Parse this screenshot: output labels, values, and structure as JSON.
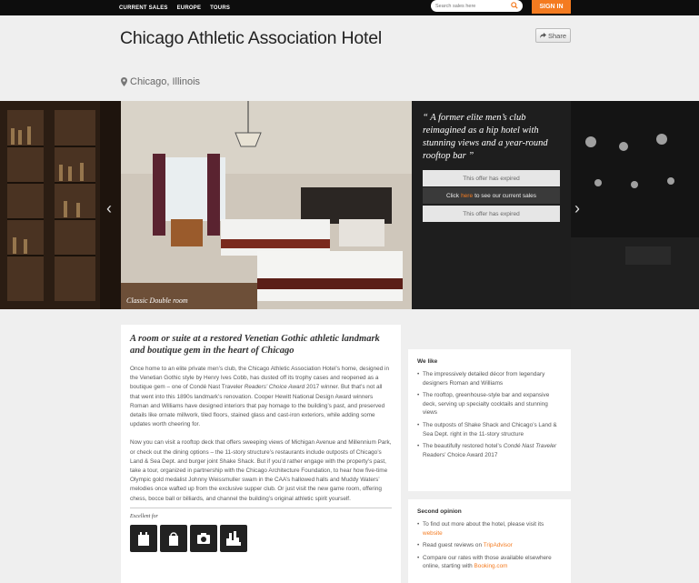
{
  "topnav": {
    "items": [
      "CURRENT SALES",
      "EUROPE",
      "TOURS"
    ],
    "search_placeholder": "Search sales here",
    "signin_label": "SIGN IN"
  },
  "header": {
    "title": "Chicago Athletic Association Hotel",
    "location": "Chicago, Illinois",
    "share_label": "Share"
  },
  "gallery": {
    "caption": "Classic Double room",
    "quote": "“ A former elite men’s club reimagined as a hip hotel with stunning views and a year-round rooftop bar ”",
    "offer_expired": "This offer has expired",
    "click_prefix": "Click",
    "click_link": "here",
    "click_suffix": "to see our current sales"
  },
  "article": {
    "headline": "A room or suite at a restored Venetian Gothic athletic landmark and boutique gem in the heart of Chicago",
    "p1_a": "Once home to an elite private men’s club, the Chicago Athletic Association Hotel’s home, designed in the Venetian Gothic style by Henry Ives Cobb, has dusted off its trophy cases and reopened as a boutique gem – one of Condé Nast Traveler ",
    "p1_em": "Readers’ Choice Award",
    "p1_b": " 2017 winner. But that’s not all that went into this 1890s landmark’s renovation. Cooper Hewitt National Design Award winners Roman and Williams have designed interiors that pay homage to the building’s past, and preserved details like ornate millwork, tiled floors, stained glass and cast-iron exteriors, while adding some updates worth cheering for.",
    "p2": "Now you can visit a rooftop deck that offers sweeping views of Michigan Avenue and Millennium Park, or check out the dining options – the 11-story structure’s restaurants include outposts of Chicago’s Land & Sea Dept. and burger joint Shake Shack. But if you’d rather engage with the property’s past, take a tour, organized in partnership with the Chicago Architecture Foundation, to hear how five-time Olympic gold medalist Johnny Weissmuller swam in the CAA’s hallowed halls and Muddy Waters’ melodies once wafted up from the exclusive supper club. Or just visit the new game room, offering chess, bocce ball or billiards, and channel the building’s original athletic spirit yourself.",
    "excellent_for": "Excellent for"
  },
  "we_like": {
    "title": "We like",
    "items": [
      "The impressively detailed décor from legendary designers Roman and Williams",
      "The rooftop, greenhouse-style bar and expansive deck, serving up specialty cocktails and stunning views",
      "The outposts of Shake Shack and Chicago’s Land & Sea Dept. right in the 11-story structure"
    ],
    "item4_a": "The beautifully restored hotel’s ",
    "item4_em": "Condé Nast Traveler",
    "item4_b": " Readers’ Choice Award 2017"
  },
  "second_opinion": {
    "title": "Second opinion",
    "item1": "To find out more about the hotel, please visit its",
    "item1_link": "website",
    "item2": "Read guest reviews on",
    "item2_link": "TripAdvisor",
    "item3": "Compare our rates with those available elsewhere online, starting with",
    "item3_link": "Booking.com"
  },
  "colors": {
    "accent": "#f47b20",
    "topbar": "#0d0d0d",
    "panel": "#1e1e1e"
  }
}
